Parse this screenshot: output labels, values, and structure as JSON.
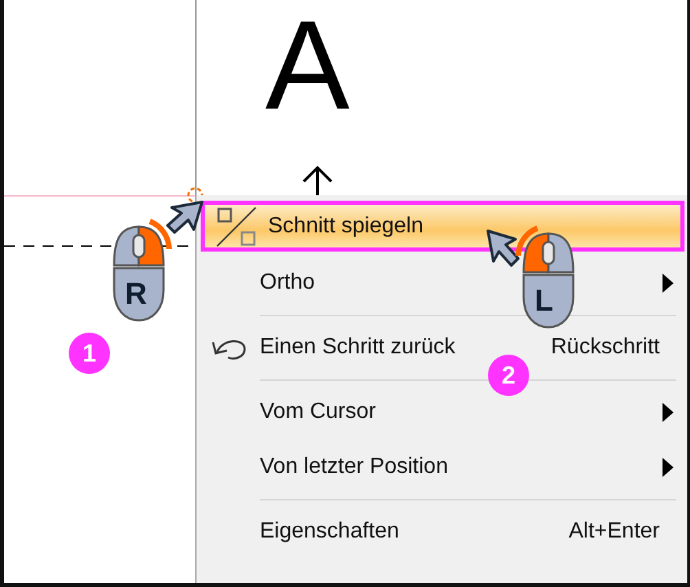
{
  "canvas": {
    "letter": "A"
  },
  "menu": {
    "items": [
      {
        "kind": "mirror",
        "label": "Schnitt spiegeln",
        "selected": true
      },
      {
        "kind": "submenu",
        "label": "Ortho",
        "selected": false
      },
      {
        "kind": "separator"
      },
      {
        "kind": "undo",
        "label": "Einen Schritt zurück",
        "shortcut": "Rückschritt",
        "selected": false
      },
      {
        "kind": "separator"
      },
      {
        "kind": "submenu",
        "label": "Vom Cursor",
        "selected": false
      },
      {
        "kind": "submenu",
        "label": "Von letzter Position",
        "selected": false
      },
      {
        "kind": "separator"
      },
      {
        "kind": "command",
        "label": "Eigenschaften",
        "shortcut": "Alt+Enter",
        "selected": false
      }
    ]
  },
  "callouts": [
    {
      "number": "1",
      "button": "R"
    },
    {
      "number": "2",
      "button": "L"
    }
  ]
}
